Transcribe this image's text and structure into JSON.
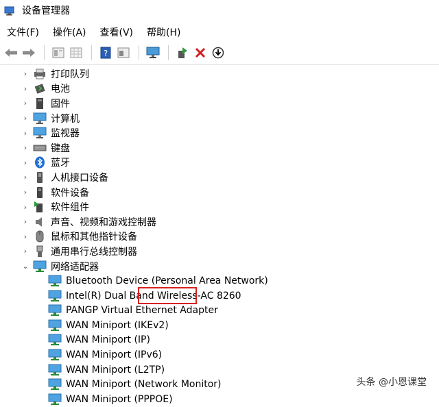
{
  "window": {
    "title": "设备管理器"
  },
  "menu": [
    "文件(F)",
    "操作(A)",
    "查看(V)",
    "帮助(H)"
  ],
  "toolbar": {
    "buttons": [
      "back-arrow",
      "forward-arrow",
      "properties",
      "grid",
      "help",
      "view-pane",
      "monitor",
      "add-driver",
      "uninstall",
      "update-download"
    ]
  },
  "tree": {
    "categories": [
      {
        "label": "打印队列",
        "icon": "printer-icon"
      },
      {
        "label": "电池",
        "icon": "battery-icon"
      },
      {
        "label": "固件",
        "icon": "firmware-icon"
      },
      {
        "label": "计算机",
        "icon": "computer-icon"
      },
      {
        "label": "监视器",
        "icon": "monitor-icon"
      },
      {
        "label": "键盘",
        "icon": "keyboard-icon"
      },
      {
        "label": "蓝牙",
        "icon": "bluetooth-icon"
      },
      {
        "label": "人机接口设备",
        "icon": "hid-icon"
      },
      {
        "label": "软件设备",
        "icon": "software-device-icon"
      },
      {
        "label": "软件组件",
        "icon": "software-component-icon"
      },
      {
        "label": "声音、视频和游戏控制器",
        "icon": "sound-icon"
      },
      {
        "label": "鼠标和其他指针设备",
        "icon": "mouse-icon"
      },
      {
        "label": "通用串行总线控制器",
        "icon": "usb-icon"
      }
    ],
    "network": {
      "label": "网络适配器",
      "children": [
        "Bluetooth Device (Personal Area Network)",
        "Intel(R) Dual Band Wireless-AC 8260",
        "PANGP Virtual Ethernet Adapter",
        "WAN Miniport (IKEv2)",
        "WAN Miniport (IP)",
        "WAN Miniport (IPv6)",
        "WAN Miniport (L2TP)",
        "WAN Miniport (Network Monitor)",
        "WAN Miniport (PPPOE)"
      ]
    }
  },
  "watermark": "头条 @小恩课堂"
}
